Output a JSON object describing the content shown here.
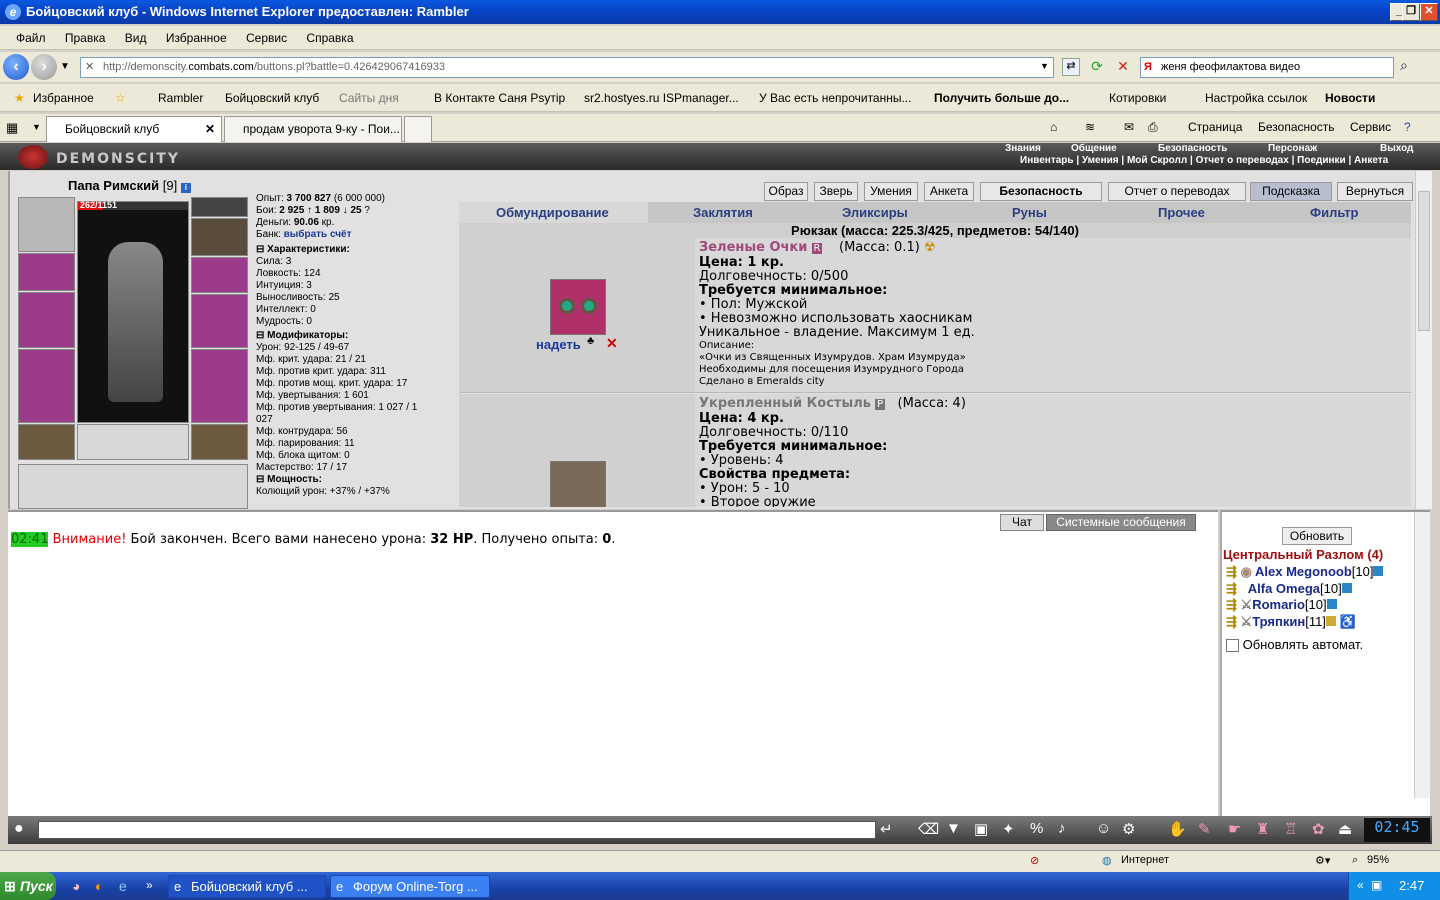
{
  "window": {
    "title": "Бойцовский клуб - Windows Internet Explorer предоставлен: Rambler"
  },
  "menu": [
    "Файл",
    "Правка",
    "Вид",
    "Избранное",
    "Сервис",
    "Справка"
  ],
  "address": {
    "prefix": "http://demonscity.",
    "domain": "combats.com",
    "path": "/buttons.pl?battle=0.426429067416933",
    "search": "женя феофилактова видео"
  },
  "favorites": {
    "label": "Избранное",
    "items": [
      "Rambler",
      "Бойцовский клуб",
      "Сайты дня",
      "В Контакте Саня Psyтip",
      "sr2.hostyes.ru ISPmanager...",
      "У Вас есть непрочитанны...",
      "Получить больше до...",
      "Котировки",
      "Настройка ссылок",
      "Новости"
    ]
  },
  "tabs": [
    "Бойцовский клуб",
    "продам уворота 9-ку - Пои..."
  ],
  "commands": [
    "Страница",
    "Безопасность",
    "Сервис"
  ],
  "game": {
    "logo": "DEMONSCITY",
    "menu_top": [
      "Знания",
      "Общение",
      "Безопасность",
      "Персонаж",
      "Выход"
    ],
    "menu_bottom": "Инвентарь | Умения | Мой Скролл | Отчет о переводах | Поединки | Анкета",
    "char": {
      "name": "Папа Римский",
      "level": "[9]",
      "hp": "262/1151"
    },
    "stats": {
      "exp_label": "Опыт:",
      "exp": "3 700 827",
      "exp_next": "(6 000 000)",
      "fights_label": "Бои:",
      "wins": "2 925",
      "losses": "1 809",
      "draws": "25",
      "money_label": "Деньги:",
      "money": "90.06",
      "money_unit": "кр.",
      "bank_label": "Банк:",
      "bank_link": "выбрать счёт",
      "char_header": "Характеристики:",
      "chars": [
        "Сила: 3",
        "Ловкость: 124",
        "Интуиция: 3",
        "Выносливость: 25",
        "Интеллект: 0",
        "Мудрость: 0"
      ],
      "mod_header": "Модификаторы:",
      "mods": [
        "Урон: 92-125 / 49-67",
        "Мф. крит. удара: 21 / 21",
        "Мф. против крит. удара: 311",
        "Мф. против мощ. крит. удара: 17",
        "Мф. увертывания: 1 601",
        "Мф. против увертывания: 1 027 / 1",
        "027",
        "Мф. контрудара: 56",
        "Мф. парирования: 11",
        "Мф. блока щитом: 0",
        "Мастерство: 17 / 17"
      ],
      "power_header": "Мощность:",
      "power": [
        "Колющий урон: +37% / +37%"
      ]
    },
    "buttons": [
      "Образ",
      "Зверь",
      "Умения",
      "Анкета",
      "Безопасность",
      "Отчет о переводах",
      "Подсказка",
      "Вернуться"
    ],
    "categories": [
      "Обмундирование",
      "Заклятия",
      "Эликсиры",
      "Руны",
      "Прочее",
      "Фильтр"
    ],
    "backpack": "Рюкзак (масса: 225.3/425, предметов: 54/140)",
    "items": [
      {
        "name": "Зеленые Очки",
        "badge": "R",
        "mass": "(Масса: 0.1)",
        "price": "Цена: 1 кр.",
        "durability": "Долговечность: 0/500",
        "req_header": "Требуется минимальное:",
        "lines": [
          "• Пол: Мужской",
          "• Невозможно использовать хаосникам",
          "Уникальное - владение. Максимум 1 ед."
        ],
        "desc_label": "Описание:",
        "desc": [
          "«Очки из Священных Изумрудов. Храм Изумруда»",
          "Необходимы для посещения Изумрудного Города",
          "Сделано в Emeralds city"
        ],
        "action": "надеть"
      },
      {
        "name": "Укрепленный Костыль",
        "badge": "P",
        "mass": "(Масса: 4)",
        "price": "Цена: 4 кр.",
        "durability": "Долговечность: 0/110",
        "req_header": "Требуется минимальное:",
        "lines": [
          "• Уровень: 4"
        ],
        "props_header": "Свойства предмета:",
        "props": [
          "• Урон: 5 - 10",
          "• Второе оружие"
        ]
      }
    ],
    "chat": {
      "tabs": [
        "Чат",
        "Системные сообщения"
      ],
      "time": "02:41",
      "warn": "Внимание!",
      "msg1": " Бой закончен. Всего вами нанесено урона: ",
      "dmg": "32 HP",
      "msg2": ". Получено опыта: ",
      "exp": "0",
      "end": "."
    },
    "online": {
      "refresh": "Обновить",
      "room": "Центральный Разлом (4)",
      "players": [
        {
          "name": "Alex Megonoob",
          "lvl": "[10]"
        },
        {
          "name": "Alfa Omega",
          "lvl": "[10]"
        },
        {
          "name": "Romario",
          "lvl": "[10]"
        },
        {
          "name": "Тряпкин",
          "lvl": "[11]"
        }
      ],
      "auto": "Обновлять автомат."
    },
    "clock": "02:45"
  },
  "status": {
    "zone": "Интернет",
    "zoom": "95%"
  },
  "taskbar": {
    "start": "Пуск",
    "items": [
      "Бойцовский клуб ...",
      "Форум Online-Torg ..."
    ],
    "time": "2:47"
  }
}
